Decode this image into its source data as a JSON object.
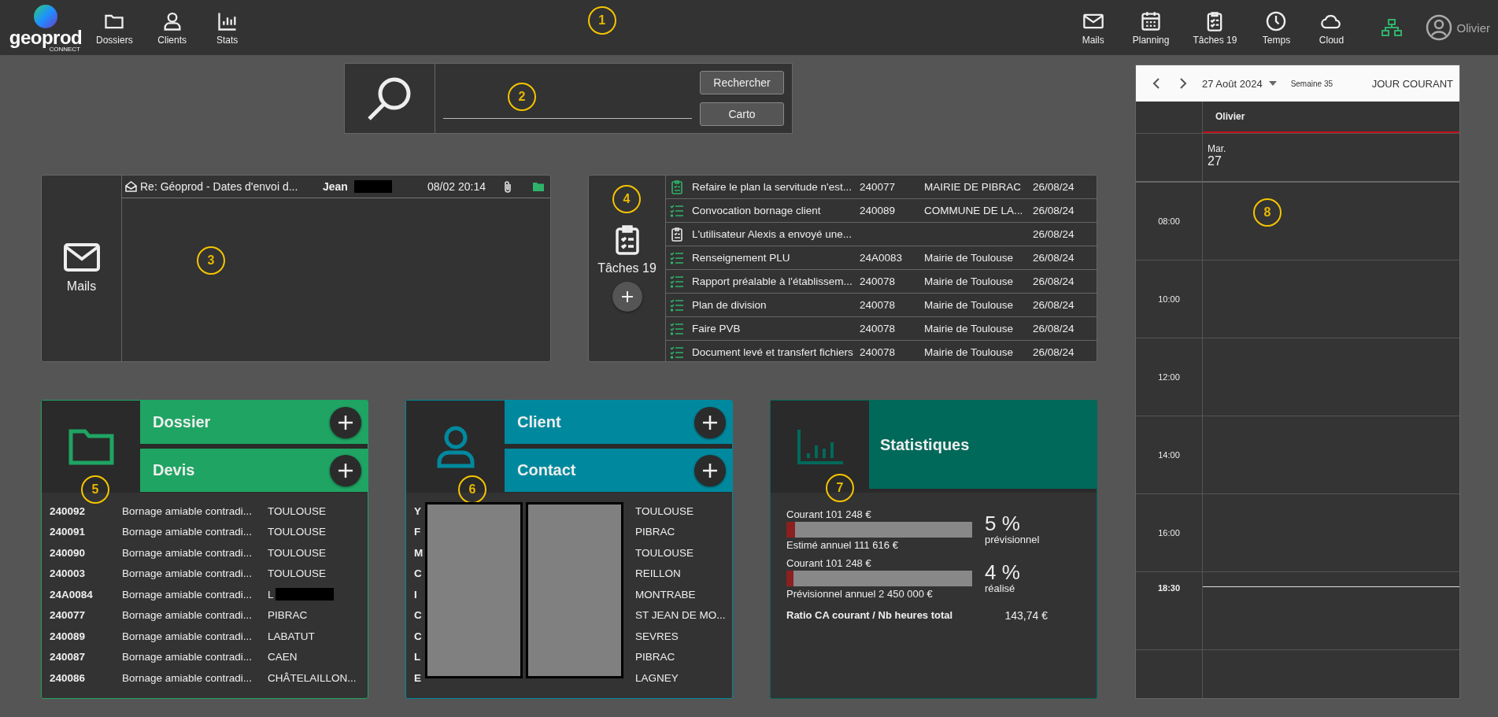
{
  "topbar": {
    "logo": "geoprod",
    "logo_sub": "CONNECT",
    "callout": "1",
    "nav_left": [
      {
        "kind": "folder",
        "label": "Dossiers"
      },
      {
        "kind": "person",
        "label": "Clients"
      },
      {
        "kind": "stats",
        "label": "Stats"
      }
    ],
    "nav_right": [
      {
        "kind": "mail",
        "label": "Mails"
      },
      {
        "kind": "calendar",
        "label": "Planning"
      },
      {
        "kind": "tasks",
        "label": "Tâches 19"
      },
      {
        "kind": "clock",
        "label": "Temps"
      },
      {
        "kind": "cloud",
        "label": "Cloud"
      }
    ],
    "user": "Olivier"
  },
  "search": {
    "callout": "2",
    "buttons": [
      "Rechercher",
      "Carto"
    ]
  },
  "mails": {
    "title": "Mails",
    "callout": "3",
    "messages": [
      {
        "subject": "Re: Géoprod - Dates d'envoi d...",
        "sender": "Jean",
        "sender_redacted": true,
        "date": "08/02 20:14",
        "attachment": true,
        "filed": true
      }
    ]
  },
  "tasks": {
    "title": "Tâches 19",
    "callout": "4",
    "rows": [
      {
        "kind": "note",
        "title": "Refaire le plan la servitude n'est...",
        "dossier": "240077",
        "client": "MAIRIE DE PIBRAC",
        "date": "26/08/24"
      },
      {
        "kind": "checklist",
        "title": "Convocation bornage client",
        "dossier": "240089",
        "client": "COMMUNE DE LA...",
        "date": "26/08/24"
      },
      {
        "kind": "message",
        "title": "L'utilisateur Alexis a envoyé une...",
        "date": "26/08/24"
      },
      {
        "kind": "checklist",
        "title": "Renseignement PLU",
        "dossier": "24A0083",
        "client": "Mairie de Toulouse",
        "date": "26/08/24"
      },
      {
        "kind": "checklist",
        "title": "Rapport préalable à l'établissem...",
        "dossier": "240078",
        "client": "Mairie de Toulouse",
        "date": "26/08/24"
      },
      {
        "kind": "checklist",
        "title": "Plan de division",
        "dossier": "240078",
        "client": "Mairie de Toulouse",
        "date": "26/08/24"
      },
      {
        "kind": "checklist",
        "title": "Faire PVB",
        "dossier": "240078",
        "client": "Mairie de Toulouse",
        "date": "26/08/24"
      },
      {
        "kind": "checklist",
        "title": "Document levé et transfert fichiers",
        "dossier": "240078",
        "client": "Mairie de Toulouse",
        "date": "26/08/24"
      }
    ]
  },
  "dossiers": {
    "callout": "5",
    "actions": [
      "Dossier",
      "Devis"
    ],
    "rows": [
      {
        "number": "240092",
        "label": "Bornage amiable contradi...",
        "city": "TOULOUSE",
        "redacted": false
      },
      {
        "number": "240091",
        "label": "Bornage amiable contradi...",
        "city": "TOULOUSE",
        "redacted": false
      },
      {
        "number": "240090",
        "label": "Bornage amiable contradi...",
        "city": "TOULOUSE",
        "redacted": false
      },
      {
        "number": "240003",
        "label": "Bornage amiable contradi...",
        "city": "TOULOUSE",
        "redacted": false
      },
      {
        "number": "24A0084",
        "label": "Bornage amiable contradi...",
        "city": "L",
        "redacted": true
      },
      {
        "number": "240077",
        "label": "Bornage amiable contradi...",
        "city": "PIBRAC",
        "redacted": false
      },
      {
        "number": "240089",
        "label": "Bornage amiable contradi...",
        "city": "LABATUT",
        "redacted": false
      },
      {
        "number": "240087",
        "label": "Bornage amiable contradi...",
        "city": "CAEN",
        "redacted": false
      },
      {
        "number": "240086",
        "label": "Bornage amiable contradi...",
        "city": "CHÂTELAILLON...",
        "redacted": false
      }
    ]
  },
  "clients": {
    "callout": "6",
    "actions": [
      "Client",
      "Contact"
    ],
    "redacted": true,
    "rows": [
      {
        "column_1": "Y",
        "city": "TOULOUSE"
      },
      {
        "column_1": "F",
        "city": "PIBRAC"
      },
      {
        "column_1": "M",
        "city": "TOULOUSE"
      },
      {
        "column_1": "C",
        "city": "REILLON"
      },
      {
        "column_1": "I",
        "city": "MONTRABE"
      },
      {
        "column_1": "C",
        "city": "ST JEAN DE MO..."
      },
      {
        "column_1": "C",
        "city": "SEVRES"
      },
      {
        "column_1": "L",
        "city": "PIBRAC"
      },
      {
        "column_1": "E",
        "city": "LAGNEY"
      }
    ]
  },
  "stats": {
    "title": "Statistiques",
    "callout": "7",
    "gauges": [
      {
        "top": "Courant 101 248 €",
        "level": 0.045,
        "bottom": "Estimé annuel 111 616 €",
        "percent": "5 %",
        "caption": "prévisionnel"
      },
      {
        "top": "Courant 101 248 €",
        "level": 0.037,
        "bottom": "Prévisionnel annuel 2 450 000 €",
        "percent": "4 %",
        "caption": "réalisé"
      }
    ],
    "ratio_label": "Ratio CA courant / Nb heures total",
    "ratio_value": "143,74 €"
  },
  "calendar": {
    "callout": "8",
    "date": "27 Août 2024",
    "week": "Semaine 35",
    "today_button": "JOUR COURANT",
    "resource": "Olivier",
    "day_name": "Mar.",
    "day_number": "27",
    "slots": [
      {
        "time": "08:00",
        "now": false
      },
      {
        "time": "10:00",
        "now": false
      },
      {
        "time": "12:00",
        "now": false
      },
      {
        "time": "14:00",
        "now": false
      },
      {
        "time": "16:00",
        "now": false
      },
      {
        "time": "18:30",
        "now": true
      }
    ]
  }
}
